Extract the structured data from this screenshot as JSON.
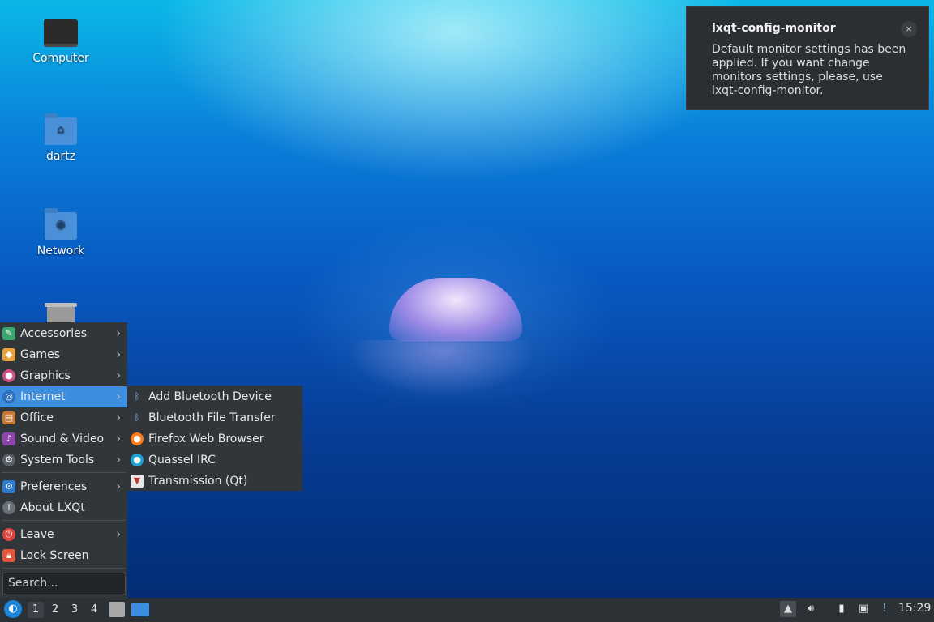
{
  "desktop": {
    "icons": [
      {
        "label": "Computer"
      },
      {
        "label": "dartz"
      },
      {
        "label": "Network"
      },
      {
        "label": "Trash"
      }
    ]
  },
  "notification": {
    "title": "lxqt-config-monitor",
    "body": "Default monitor settings has been applied. If you want change monitors settings, please, use lxqt-config-monitor.",
    "close_glyph": "×"
  },
  "menu": {
    "items": [
      {
        "label": "Accessories",
        "icon": "accessories-icon"
      },
      {
        "label": "Games",
        "icon": "games-icon"
      },
      {
        "label": "Graphics",
        "icon": "graphics-icon"
      },
      {
        "label": "Internet",
        "icon": "internet-icon",
        "active": true
      },
      {
        "label": "Office",
        "icon": "office-icon"
      },
      {
        "label": "Sound & Video",
        "icon": "sound-video-icon"
      },
      {
        "label": "System Tools",
        "icon": "system-tools-icon"
      },
      {
        "label": "Preferences",
        "icon": "preferences-icon"
      },
      {
        "label": "About LXQt",
        "icon": "info-icon"
      },
      {
        "label": "Leave",
        "icon": "power-icon"
      },
      {
        "label": "Lock Screen",
        "icon": "lock-icon"
      }
    ],
    "search_placeholder": "Search...",
    "chevron": "›"
  },
  "submenu": {
    "items": [
      {
        "label": "Add Bluetooth Device",
        "icon": "bluetooth-icon"
      },
      {
        "label": "Bluetooth File Transfer",
        "icon": "bluetooth-icon"
      },
      {
        "label": "Firefox Web Browser",
        "icon": "firefox-icon"
      },
      {
        "label": "Quassel IRC",
        "icon": "quassel-icon"
      },
      {
        "label": "Transmission (Qt)",
        "icon": "transmission-icon"
      }
    ]
  },
  "taskbar": {
    "desktops": [
      "1",
      "2",
      "3",
      "4"
    ],
    "current_desktop": "1",
    "clock": "15:29"
  },
  "colors": {
    "menu_bg": "#31363b",
    "highlight": "#3d8ee0",
    "taskbar_bg": "#2c3136"
  }
}
